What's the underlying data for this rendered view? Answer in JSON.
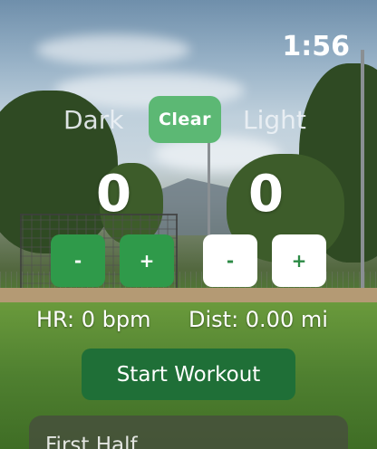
{
  "status": {
    "time": "1:56"
  },
  "teams": {
    "dark": {
      "label": "Dark",
      "score": "0"
    },
    "light": {
      "label": "Light",
      "score": "0"
    }
  },
  "controls": {
    "clear_label": "Clear",
    "minus_label": "-",
    "plus_label": "+"
  },
  "stats": {
    "heart_rate": "HR: 0 bpm",
    "distance": "Dist: 0.00 mi"
  },
  "workout": {
    "start_label": "Start Workout"
  },
  "period": {
    "label": "First Half"
  },
  "colors": {
    "clear_button": "#5cb874",
    "dark_buttons": "#2f9a4a",
    "light_buttons": "#ffffff",
    "start_button": "#1f6f37"
  }
}
